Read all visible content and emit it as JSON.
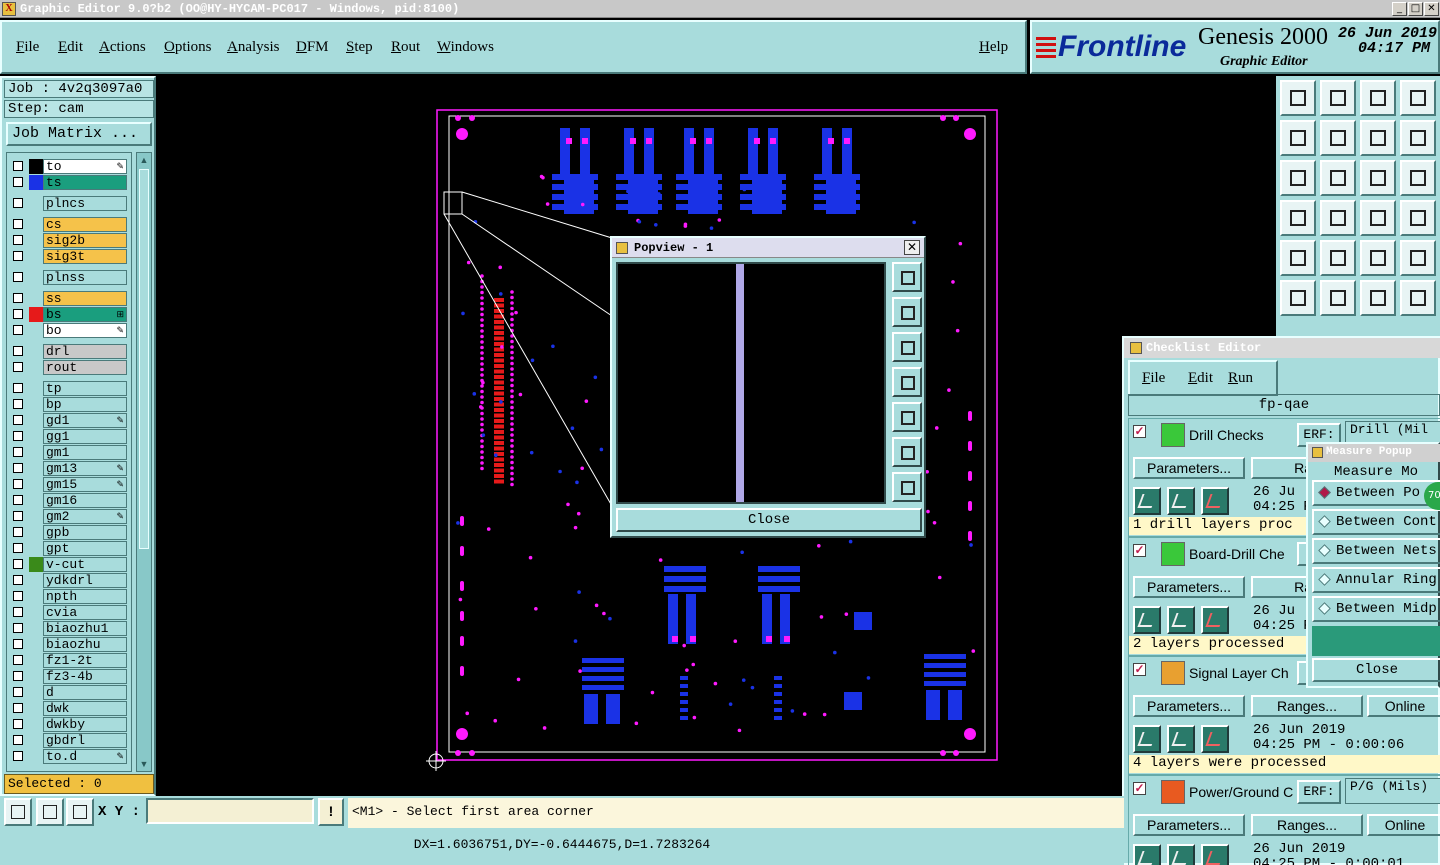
{
  "window": {
    "title": "Graphic Editor 9.0?b2 (OO@HY-HYCAM-PC017 - Windows, pid:8100)",
    "minimize": "_",
    "maximize": "□",
    "close": "✕"
  },
  "menu": {
    "file": "File",
    "edit": "Edit",
    "actions": "Actions",
    "options": "Options",
    "analysis": "Analysis",
    "dfm": "DFM",
    "step": "Step",
    "rout": "Rout",
    "windows": "Windows",
    "help": "Help"
  },
  "brand": {
    "logo": "Frontline",
    "product": "Genesis 2000",
    "subtitle": "Graphic Editor",
    "date": "26 Jun 2019",
    "time": "04:17 PM"
  },
  "job": {
    "job_label": "Job : 4v2q3097a0",
    "step_label": "Step: cam",
    "job_matrix": "Job Matrix ..."
  },
  "layers": [
    {
      "name": "to",
      "color": "#ffffff",
      "swatch": "#000000",
      "flag": "✎"
    },
    {
      "name": "ts",
      "color": "#1a9e7e",
      "swatch": "#1a32e6",
      "flag": ""
    },
    {
      "name": "plncs",
      "color": "#a8dcdc",
      "swatch": "",
      "flag": ""
    },
    {
      "name": "cs",
      "color": "#f5c24a",
      "swatch": "",
      "flag": ""
    },
    {
      "name": "sig2b",
      "color": "#f5c24a",
      "swatch": "",
      "flag": ""
    },
    {
      "name": "sig3t",
      "color": "#f5c24a",
      "swatch": "",
      "flag": ""
    },
    {
      "name": "plnss",
      "color": "#a8dcdc",
      "swatch": "",
      "flag": ""
    },
    {
      "name": "ss",
      "color": "#f5c24a",
      "swatch": "",
      "flag": ""
    },
    {
      "name": "bs",
      "color": "#1a9e7e",
      "swatch": "#e61a1a",
      "flag": "⊞"
    },
    {
      "name": "bo",
      "color": "#ffffff",
      "swatch": "",
      "flag": "✎"
    },
    {
      "name": "drl",
      "color": "#c8c8c8",
      "swatch": "",
      "flag": ""
    },
    {
      "name": "rout",
      "color": "#c8c8c8",
      "swatch": "",
      "flag": ""
    },
    {
      "name": "tp",
      "color": "#a8dcdc",
      "swatch": "",
      "flag": ""
    },
    {
      "name": "bp",
      "color": "#a8dcdc",
      "swatch": "",
      "flag": ""
    },
    {
      "name": "gd1",
      "color": "#a8dcdc",
      "swatch": "",
      "flag": "✎"
    },
    {
      "name": "gg1",
      "color": "#a8dcdc",
      "swatch": "",
      "flag": ""
    },
    {
      "name": "gm1",
      "color": "#a8dcdc",
      "swatch": "",
      "flag": ""
    },
    {
      "name": "gm13",
      "color": "#a8dcdc",
      "swatch": "",
      "flag": "✎"
    },
    {
      "name": "gm15",
      "color": "#a8dcdc",
      "swatch": "",
      "flag": "✎"
    },
    {
      "name": "gm16",
      "color": "#a8dcdc",
      "swatch": "",
      "flag": ""
    },
    {
      "name": "gm2",
      "color": "#a8dcdc",
      "swatch": "",
      "flag": "✎"
    },
    {
      "name": "gpb",
      "color": "#a8dcdc",
      "swatch": "",
      "flag": ""
    },
    {
      "name": "gpt",
      "color": "#a8dcdc",
      "swatch": "",
      "flag": ""
    },
    {
      "name": "v-cut",
      "color": "#a8dcdc",
      "swatch": "#3a8a1a",
      "flag": ""
    },
    {
      "name": "ydkdrl",
      "color": "#a8dcdc",
      "swatch": "",
      "flag": ""
    },
    {
      "name": "npth",
      "color": "#a8dcdc",
      "swatch": "",
      "flag": ""
    },
    {
      "name": "cvia",
      "color": "#a8dcdc",
      "swatch": "",
      "flag": ""
    },
    {
      "name": "biaozhu1",
      "color": "#a8dcdc",
      "swatch": "",
      "flag": ""
    },
    {
      "name": "biaozhu",
      "color": "#a8dcdc",
      "swatch": "",
      "flag": ""
    },
    {
      "name": "fz1-2t",
      "color": "#a8dcdc",
      "swatch": "",
      "flag": ""
    },
    {
      "name": "fz3-4b",
      "color": "#a8dcdc",
      "swatch": "",
      "flag": ""
    },
    {
      "name": "d",
      "color": "#a8dcdc",
      "swatch": "",
      "flag": ""
    },
    {
      "name": "dwk",
      "color": "#a8dcdc",
      "swatch": "",
      "flag": ""
    },
    {
      "name": "dwkby",
      "color": "#a8dcdc",
      "swatch": "",
      "flag": ""
    },
    {
      "name": "gbdrl",
      "color": "#a8dcdc",
      "swatch": "",
      "flag": ""
    },
    {
      "name": "to.d",
      "color": "#a8dcdc",
      "swatch": "",
      "flag": "✎"
    }
  ],
  "selected": "Selected : 0",
  "popview": {
    "title": "Popview - 1",
    "close": "Close"
  },
  "checklist": {
    "title": "Checklist Editor",
    "menu": {
      "file": "File",
      "edit": "Edit",
      "run": "Run"
    },
    "name": "fp-qae",
    "items": [
      {
        "name": "Drill Checks",
        "erf": "ERF:",
        "erf_value": "Drill (Mil",
        "params": "Parameters...",
        "ranges": "Ran",
        "online": "",
        "date": "26 Ju",
        "time": "04:25 PM",
        "status": "1 drill layers proc",
        "icon_color": "#3ac83a"
      },
      {
        "name": "Board-Drill Che",
        "erf": "E",
        "erf_value": "",
        "params": "Parameters...",
        "ranges": "Ran",
        "online": "",
        "date": "26 Ju",
        "time": "04:25 PM",
        "status": "2 layers processed",
        "icon_color": "#3ac83a"
      },
      {
        "name": "Signal Layer Ch",
        "erf": "E",
        "erf_value": "",
        "params": "Parameters...",
        "ranges": "Ranges...",
        "online": "Online",
        "date": "26 Jun 2019",
        "time": "04:25 PM - 0:00:06",
        "status": "4 layers were processed",
        "icon_color": "#e8a030"
      },
      {
        "name": "Power/Ground C",
        "erf": "ERF:",
        "erf_value": "P/G (Mils)",
        "params": "Parameters...",
        "ranges": "Ranges...",
        "online": "Online",
        "date": "26 Jun 2019",
        "time": "04:25 PM - 0:00:01",
        "status": "",
        "icon_color": "#e85a20"
      }
    ]
  },
  "measure": {
    "title": "Measure Popup",
    "mode_title": "Measure Mo",
    "options": [
      "Between Po",
      "Between Cont",
      "Between Nets",
      "Annular Ring",
      "Between Midp"
    ],
    "selected_index": 0,
    "badge": "70",
    "close": "Close"
  },
  "bottom": {
    "xy_label": "X Y :",
    "xy_value": "",
    "excl": "!",
    "prompt": "<M1> - Select first area corner",
    "status": "DX=1.6036751,DY=-0.6444675,D=1.7283264"
  },
  "colors": {
    "panel": "#a8dcdc",
    "pad_magenta": "#ff1aff",
    "pad_blue": "#1a32e6",
    "pad_red": "#e61a1a",
    "profile": "#ff1aff"
  }
}
